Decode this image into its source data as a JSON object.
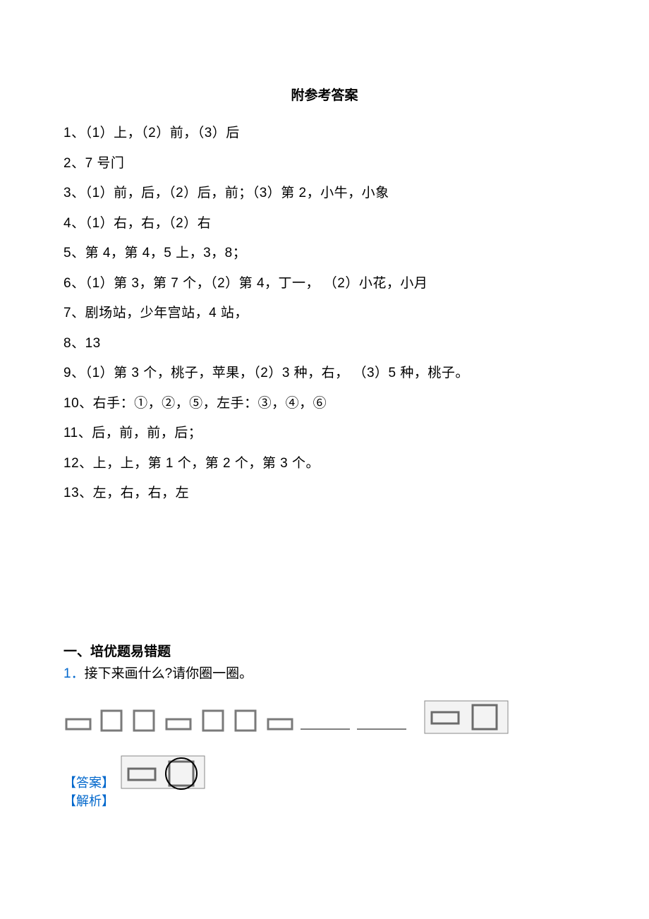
{
  "title": "附参考答案",
  "answers": [
    "1、（1）上，（2）前，（3）后",
    "2、7 号门",
    "3、（1）前，后，（2）后，前；（3）第 2，小牛，小象",
    "4、（1）右，右，（2）右",
    "5、第 4，第 4，5 上，3，8；",
    "6、（1）第 3，第 7 个，（2）第 4，丁一，  （2）小花，小月",
    "7、剧场站，少年宫站，4 站，",
    "8、13",
    "9、（1）第 3 个，桃子，苹果，（2）3 种，右，  （3）5 种，桃子。",
    "10、右手：①，②，⑤，左手：③，④，⑥",
    "11、后，前，前，后；",
    "12、上，上，第 1 个，第 2 个，第 3 个。",
    "13、左，右，右，左"
  ],
  "section_heading": "一、培优题易错题",
  "q1": {
    "num": "1．",
    "text": "接下来画什么?请你圈一圈。"
  },
  "labels": {
    "answer": "【答案】",
    "analysis": "【解析】"
  }
}
